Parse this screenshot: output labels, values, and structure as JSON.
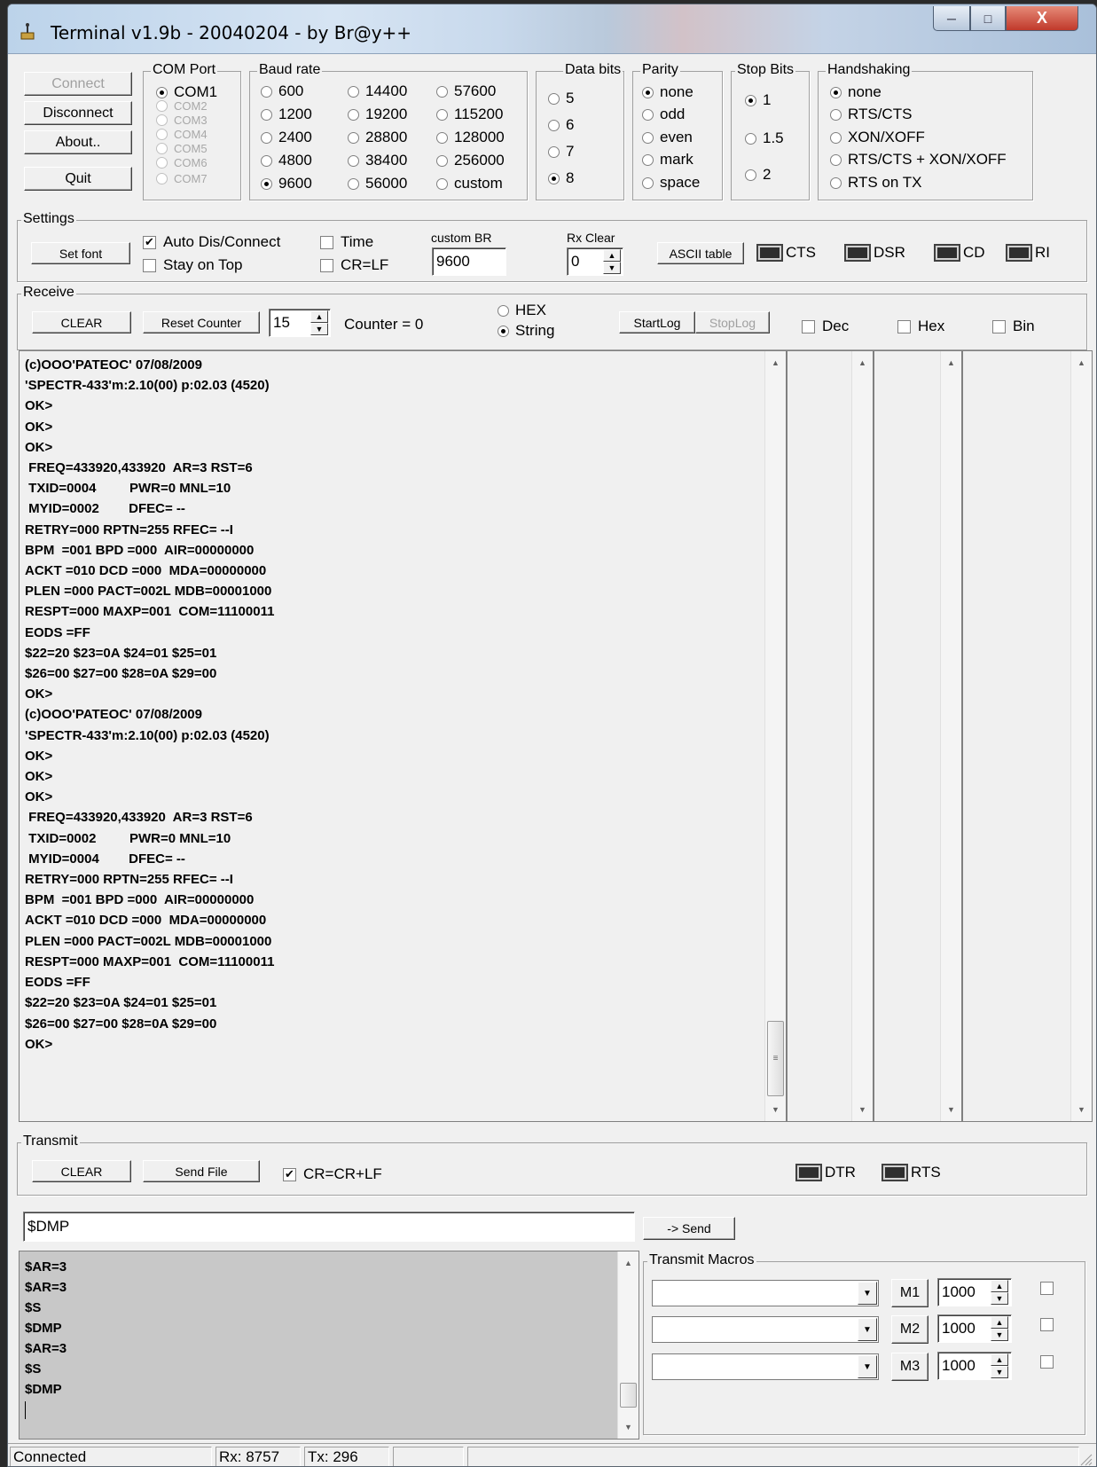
{
  "window": {
    "title": "Terminal v1.9b - 20040204 - by Br@y++"
  },
  "connection": {
    "connect": "Connect",
    "disconnect": "Disconnect",
    "about": "About..",
    "quit": "Quit"
  },
  "com_port": {
    "legend": "COM Port",
    "ports": [
      "COM1",
      "COM2",
      "COM3",
      "COM4",
      "COM5",
      "COM6",
      "COM7"
    ],
    "selected": "COM1"
  },
  "baud_rate": {
    "legend": "Baud rate",
    "options": [
      "600",
      "1200",
      "2400",
      "4800",
      "9600",
      "14400",
      "19200",
      "28800",
      "38400",
      "56000",
      "57600",
      "115200",
      "128000",
      "256000",
      "custom"
    ],
    "selected": "9600"
  },
  "data_bits": {
    "legend": "Data bits",
    "options": [
      "5",
      "6",
      "7",
      "8"
    ],
    "selected": "8"
  },
  "parity": {
    "legend": "Parity",
    "options": [
      "none",
      "odd",
      "even",
      "mark",
      "space"
    ],
    "selected": "none"
  },
  "stop_bits": {
    "legend": "Stop Bits",
    "options": [
      "1",
      "1.5",
      "2"
    ],
    "selected": "1"
  },
  "handshaking": {
    "legend": "Handshaking",
    "options": [
      "none",
      "RTS/CTS",
      "XON/XOFF",
      "RTS/CTS + XON/XOFF",
      "RTS on TX"
    ],
    "selected": "none"
  },
  "settings": {
    "legend": "Settings",
    "set_font": "Set font",
    "auto_dis_connect": "Auto Dis/Connect",
    "stay_on_top": "Stay on Top",
    "time": "Time",
    "cr_lf": "CR=LF",
    "custom_br_label": "custom BR",
    "custom_br_value": "9600",
    "rx_clear_label": "Rx Clear",
    "rx_clear_value": "0",
    "ascii_table": "ASCII table",
    "cts": "CTS",
    "dsr": "DSR",
    "cd": "CD",
    "ri": "RI"
  },
  "receive": {
    "legend": "Receive",
    "clear": "CLEAR",
    "reset_counter": "Reset Counter",
    "counter_spin": "15",
    "counter_text": "Counter = 0",
    "hex": "HEX",
    "string": "String",
    "mode": "String",
    "start_log": "StartLog",
    "stop_log": "StopLog",
    "dec": "Dec",
    "hex_check": "Hex",
    "bin": "Bin",
    "lines": [
      "(c)OOO'PATEOC' 07/08/2009",
      "'SPECTR-433'm:2.10(00) p:02.03 (4520)",
      "OK>",
      "OK>",
      "OK>",
      " FREQ=433920,433920  AR=3 RST=6",
      " TXID=0004         PWR=0 MNL=10",
      " MYID=0002        DFEC= --",
      "RETRY=000 RPTN=255 RFEC= --I",
      "BPM  =001 BPD =000  AIR=00000000",
      "ACKT =010 DCD =000  MDA=00000000",
      "PLEN =000 PACT=002L MDB=00001000",
      "RESPT=000 MAXP=001  COM=11100011",
      "EODS =FF",
      "$22=20 $23=0A $24=01 $25=01",
      "$26=00 $27=00 $28=0A $29=00",
      "OK>",
      "(c)OOO'PATEOC' 07/08/2009",
      "'SPECTR-433'm:2.10(00) p:02.03 (4520)",
      "OK>",
      "OK>",
      "OK>",
      " FREQ=433920,433920  AR=3 RST=6",
      " TXID=0002         PWR=0 MNL=10",
      " MYID=0004        DFEC= --",
      "RETRY=000 RPTN=255 RFEC= --I",
      "BPM  =001 BPD =000  AIR=00000000",
      "ACKT =010 DCD =000  MDA=00000000",
      "PLEN =000 PACT=002L MDB=00001000",
      "RESPT=000 MAXP=001  COM=11100011",
      "EODS =FF",
      "$22=20 $23=0A $24=01 $25=01",
      "$26=00 $27=00 $28=0A $29=00",
      "OK>"
    ]
  },
  "transmit": {
    "legend": "Transmit",
    "clear": "CLEAR",
    "send_file": "Send File",
    "cr_crlf": "CR=CR+LF",
    "dtr": "DTR",
    "rts": "RTS",
    "input_value": "$DMP",
    "send": "-> Send",
    "history": [
      "$AR=3",
      "$AR=3",
      "$S",
      "$DMP",
      "$AR=3",
      "$S",
      "$DMP"
    ]
  },
  "macros": {
    "legend": "Transmit Macros",
    "items": [
      {
        "label": "M1",
        "interval": "1000"
      },
      {
        "label": "M2",
        "interval": "1000"
      },
      {
        "label": "M3",
        "interval": "1000"
      }
    ]
  },
  "status": {
    "connection": "Connected",
    "rx": "Rx: 8757",
    "tx": "Tx: 296"
  }
}
